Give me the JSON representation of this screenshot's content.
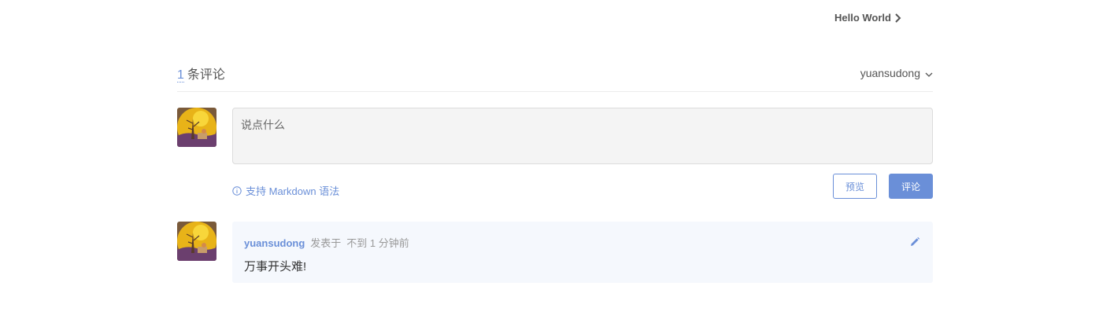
{
  "nav": {
    "next_post_title": "Hello World"
  },
  "comments": {
    "count": "1",
    "count_label": "条评论",
    "current_user": "yuansudong"
  },
  "editor": {
    "placeholder": "说点什么",
    "tip": "支持 Markdown 语法",
    "preview_label": "预览",
    "submit_label": "评论"
  },
  "comment_list": [
    {
      "author": "yuansudong",
      "posted_label": "发表于",
      "time": "不到 1 分钟前",
      "content": "万事开头难!"
    }
  ],
  "colors": {
    "accent": "#6a8fd8",
    "comment_bg": "#f5f8fd",
    "input_bg": "#f4f4f4"
  },
  "icons": {
    "next": "chevron-right-icon",
    "user_menu": "chevron-down-icon",
    "tip": "info-circle-icon",
    "edit": "pencil-icon"
  }
}
